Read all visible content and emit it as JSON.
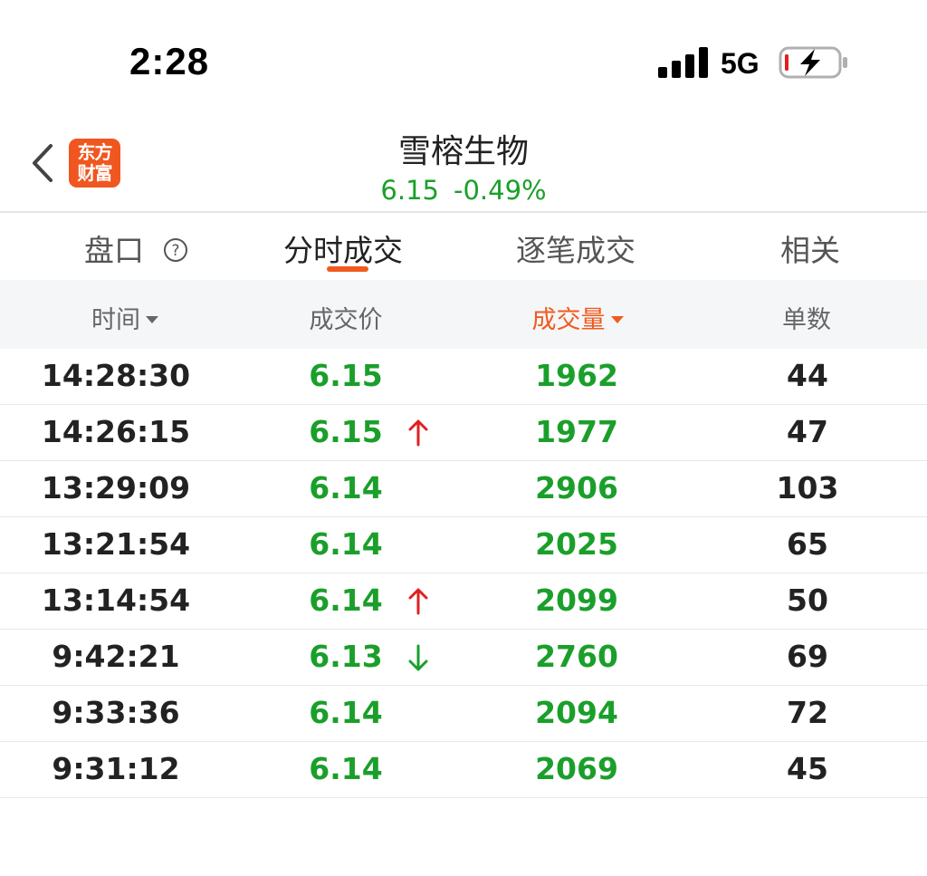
{
  "status_bar": {
    "time": "2:28",
    "network": "5G"
  },
  "header": {
    "logo_line1": "东方",
    "logo_line2": "财富",
    "stock_name": "雪榕生物",
    "price": "6.15",
    "change_pct": "-0.49%"
  },
  "tabs": [
    {
      "label": "盘口",
      "active": false
    },
    {
      "label": "分时成交",
      "active": true
    },
    {
      "label": "逐笔成交",
      "active": false
    },
    {
      "label": "相关",
      "active": false
    }
  ],
  "colors": {
    "accent": "#f05a1e",
    "down_green": "#1a9f2a",
    "up_red": "#e02020"
  },
  "table": {
    "columns": [
      "时间",
      "成交价",
      "成交量",
      "单数"
    ],
    "sorted_column": "成交量",
    "rows": [
      {
        "time": "14:28:30",
        "price": "6.15",
        "arrow": "",
        "volume": "1962",
        "count": "44"
      },
      {
        "time": "14:26:15",
        "price": "6.15",
        "arrow": "up",
        "volume": "1977",
        "count": "47"
      },
      {
        "time": "13:29:09",
        "price": "6.14",
        "arrow": "",
        "volume": "2906",
        "count": "103"
      },
      {
        "time": "13:21:54",
        "price": "6.14",
        "arrow": "",
        "volume": "2025",
        "count": "65"
      },
      {
        "time": "13:14:54",
        "price": "6.14",
        "arrow": "up",
        "volume": "2099",
        "count": "50"
      },
      {
        "time": "9:42:21",
        "price": "6.13",
        "arrow": "down",
        "volume": "2760",
        "count": "69"
      },
      {
        "time": "9:33:36",
        "price": "6.14",
        "arrow": "",
        "volume": "2094",
        "count": "72"
      },
      {
        "time": "9:31:12",
        "price": "6.14",
        "arrow": "",
        "volume": "2069",
        "count": "45"
      }
    ]
  }
}
